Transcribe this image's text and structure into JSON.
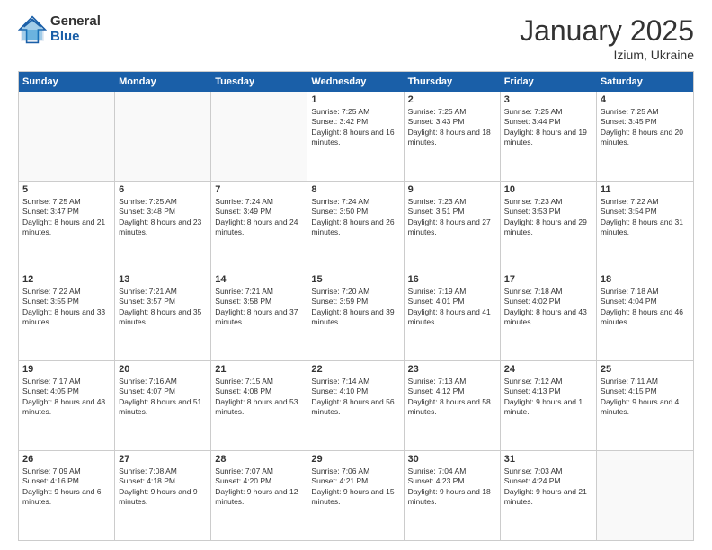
{
  "logo": {
    "general": "General",
    "blue": "Blue"
  },
  "header": {
    "month": "January 2025",
    "location": "Izium, Ukraine"
  },
  "weekdays": [
    "Sunday",
    "Monday",
    "Tuesday",
    "Wednesday",
    "Thursday",
    "Friday",
    "Saturday"
  ],
  "weeks": [
    [
      {
        "day": "",
        "empty": true
      },
      {
        "day": "",
        "empty": true
      },
      {
        "day": "",
        "empty": true
      },
      {
        "day": "1",
        "sunrise": "Sunrise: 7:25 AM",
        "sunset": "Sunset: 3:42 PM",
        "daylight": "Daylight: 8 hours and 16 minutes."
      },
      {
        "day": "2",
        "sunrise": "Sunrise: 7:25 AM",
        "sunset": "Sunset: 3:43 PM",
        "daylight": "Daylight: 8 hours and 18 minutes."
      },
      {
        "day": "3",
        "sunrise": "Sunrise: 7:25 AM",
        "sunset": "Sunset: 3:44 PM",
        "daylight": "Daylight: 8 hours and 19 minutes."
      },
      {
        "day": "4",
        "sunrise": "Sunrise: 7:25 AM",
        "sunset": "Sunset: 3:45 PM",
        "daylight": "Daylight: 8 hours and 20 minutes."
      }
    ],
    [
      {
        "day": "5",
        "sunrise": "Sunrise: 7:25 AM",
        "sunset": "Sunset: 3:47 PM",
        "daylight": "Daylight: 8 hours and 21 minutes."
      },
      {
        "day": "6",
        "sunrise": "Sunrise: 7:25 AM",
        "sunset": "Sunset: 3:48 PM",
        "daylight": "Daylight: 8 hours and 23 minutes."
      },
      {
        "day": "7",
        "sunrise": "Sunrise: 7:24 AM",
        "sunset": "Sunset: 3:49 PM",
        "daylight": "Daylight: 8 hours and 24 minutes."
      },
      {
        "day": "8",
        "sunrise": "Sunrise: 7:24 AM",
        "sunset": "Sunset: 3:50 PM",
        "daylight": "Daylight: 8 hours and 26 minutes."
      },
      {
        "day": "9",
        "sunrise": "Sunrise: 7:23 AM",
        "sunset": "Sunset: 3:51 PM",
        "daylight": "Daylight: 8 hours and 27 minutes."
      },
      {
        "day": "10",
        "sunrise": "Sunrise: 7:23 AM",
        "sunset": "Sunset: 3:53 PM",
        "daylight": "Daylight: 8 hours and 29 minutes."
      },
      {
        "day": "11",
        "sunrise": "Sunrise: 7:22 AM",
        "sunset": "Sunset: 3:54 PM",
        "daylight": "Daylight: 8 hours and 31 minutes."
      }
    ],
    [
      {
        "day": "12",
        "sunrise": "Sunrise: 7:22 AM",
        "sunset": "Sunset: 3:55 PM",
        "daylight": "Daylight: 8 hours and 33 minutes."
      },
      {
        "day": "13",
        "sunrise": "Sunrise: 7:21 AM",
        "sunset": "Sunset: 3:57 PM",
        "daylight": "Daylight: 8 hours and 35 minutes."
      },
      {
        "day": "14",
        "sunrise": "Sunrise: 7:21 AM",
        "sunset": "Sunset: 3:58 PM",
        "daylight": "Daylight: 8 hours and 37 minutes."
      },
      {
        "day": "15",
        "sunrise": "Sunrise: 7:20 AM",
        "sunset": "Sunset: 3:59 PM",
        "daylight": "Daylight: 8 hours and 39 minutes."
      },
      {
        "day": "16",
        "sunrise": "Sunrise: 7:19 AM",
        "sunset": "Sunset: 4:01 PM",
        "daylight": "Daylight: 8 hours and 41 minutes."
      },
      {
        "day": "17",
        "sunrise": "Sunrise: 7:18 AM",
        "sunset": "Sunset: 4:02 PM",
        "daylight": "Daylight: 8 hours and 43 minutes."
      },
      {
        "day": "18",
        "sunrise": "Sunrise: 7:18 AM",
        "sunset": "Sunset: 4:04 PM",
        "daylight": "Daylight: 8 hours and 46 minutes."
      }
    ],
    [
      {
        "day": "19",
        "sunrise": "Sunrise: 7:17 AM",
        "sunset": "Sunset: 4:05 PM",
        "daylight": "Daylight: 8 hours and 48 minutes."
      },
      {
        "day": "20",
        "sunrise": "Sunrise: 7:16 AM",
        "sunset": "Sunset: 4:07 PM",
        "daylight": "Daylight: 8 hours and 51 minutes."
      },
      {
        "day": "21",
        "sunrise": "Sunrise: 7:15 AM",
        "sunset": "Sunset: 4:08 PM",
        "daylight": "Daylight: 8 hours and 53 minutes."
      },
      {
        "day": "22",
        "sunrise": "Sunrise: 7:14 AM",
        "sunset": "Sunset: 4:10 PM",
        "daylight": "Daylight: 8 hours and 56 minutes."
      },
      {
        "day": "23",
        "sunrise": "Sunrise: 7:13 AM",
        "sunset": "Sunset: 4:12 PM",
        "daylight": "Daylight: 8 hours and 58 minutes."
      },
      {
        "day": "24",
        "sunrise": "Sunrise: 7:12 AM",
        "sunset": "Sunset: 4:13 PM",
        "daylight": "Daylight: 9 hours and 1 minute."
      },
      {
        "day": "25",
        "sunrise": "Sunrise: 7:11 AM",
        "sunset": "Sunset: 4:15 PM",
        "daylight": "Daylight: 9 hours and 4 minutes."
      }
    ],
    [
      {
        "day": "26",
        "sunrise": "Sunrise: 7:09 AM",
        "sunset": "Sunset: 4:16 PM",
        "daylight": "Daylight: 9 hours and 6 minutes."
      },
      {
        "day": "27",
        "sunrise": "Sunrise: 7:08 AM",
        "sunset": "Sunset: 4:18 PM",
        "daylight": "Daylight: 9 hours and 9 minutes."
      },
      {
        "day": "28",
        "sunrise": "Sunrise: 7:07 AM",
        "sunset": "Sunset: 4:20 PM",
        "daylight": "Daylight: 9 hours and 12 minutes."
      },
      {
        "day": "29",
        "sunrise": "Sunrise: 7:06 AM",
        "sunset": "Sunset: 4:21 PM",
        "daylight": "Daylight: 9 hours and 15 minutes."
      },
      {
        "day": "30",
        "sunrise": "Sunrise: 7:04 AM",
        "sunset": "Sunset: 4:23 PM",
        "daylight": "Daylight: 9 hours and 18 minutes."
      },
      {
        "day": "31",
        "sunrise": "Sunrise: 7:03 AM",
        "sunset": "Sunset: 4:24 PM",
        "daylight": "Daylight: 9 hours and 21 minutes."
      },
      {
        "day": "",
        "empty": true
      }
    ]
  ]
}
